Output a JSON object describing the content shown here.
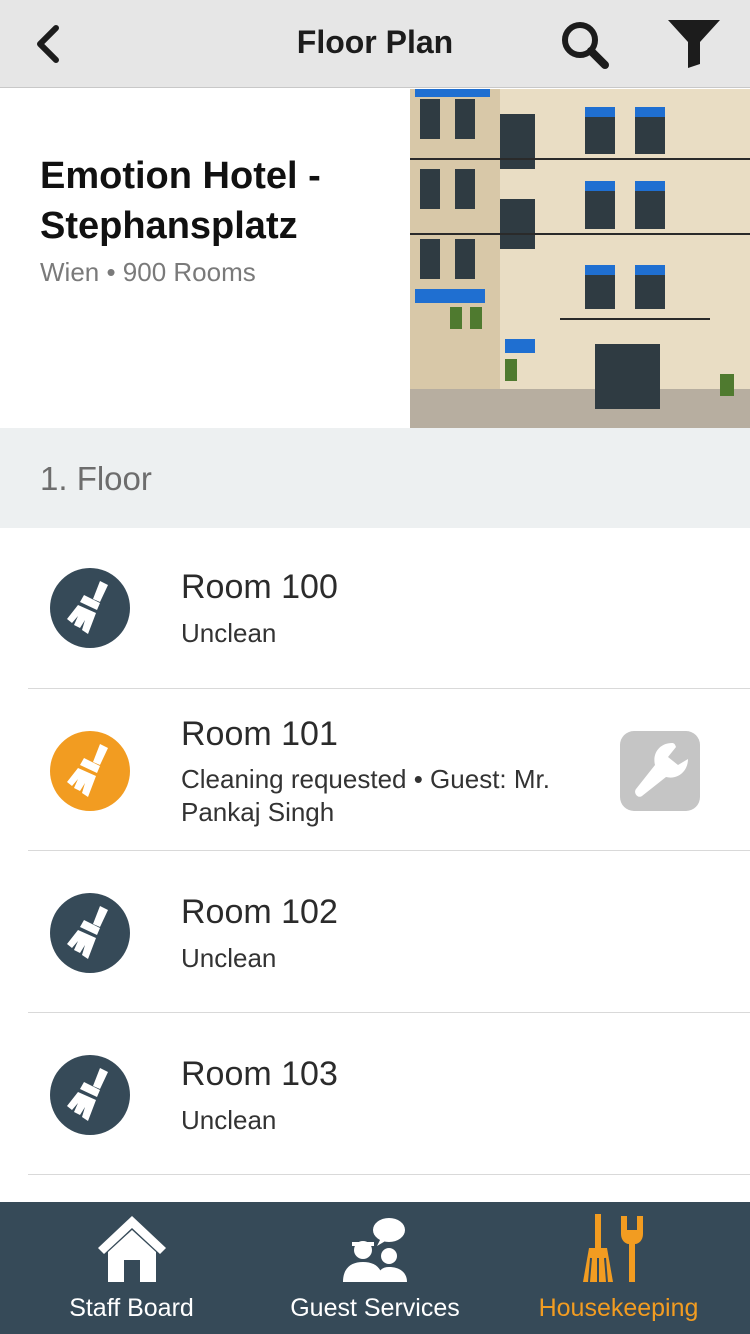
{
  "nav": {
    "title": "Floor Plan",
    "back_icon": "chevron-left-icon",
    "search_icon": "search-icon",
    "filter_icon": "filter-icon"
  },
  "hotel": {
    "name": "Emotion Hotel - Stephansplatz",
    "meta": "Wien • 900 Rooms",
    "photo": "hotel-building-photo"
  },
  "floor": {
    "label": "1. Floor"
  },
  "rooms": [
    {
      "name": "Room 100",
      "status": "Unclean",
      "icon": "broom-icon",
      "color": "#364a58"
    },
    {
      "name": "Room 101",
      "status": "Cleaning requested • Guest: Mr. Pankaj Singh",
      "icon": "broom-icon",
      "color": "#f29c21",
      "action_icon": "wrench-icon"
    },
    {
      "name": "Room 102",
      "status": "Unclean",
      "icon": "broom-icon",
      "color": "#364a58"
    },
    {
      "name": "Room 103",
      "status": "Unclean",
      "icon": "broom-icon",
      "color": "#364a58"
    }
  ],
  "tabs": [
    {
      "label": "Staff Board",
      "icon": "home-icon",
      "active": false
    },
    {
      "label": "Guest Services",
      "icon": "guest-services-icon",
      "active": false
    },
    {
      "label": "Housekeeping",
      "icon": "broom-wrench-icon",
      "active": true
    }
  ],
  "colors": {
    "active_tab": "#f29c21",
    "tabbar_bg": "#364a58",
    "nav_bg": "#e6e6e6",
    "floor_bg": "#edf0f1"
  }
}
